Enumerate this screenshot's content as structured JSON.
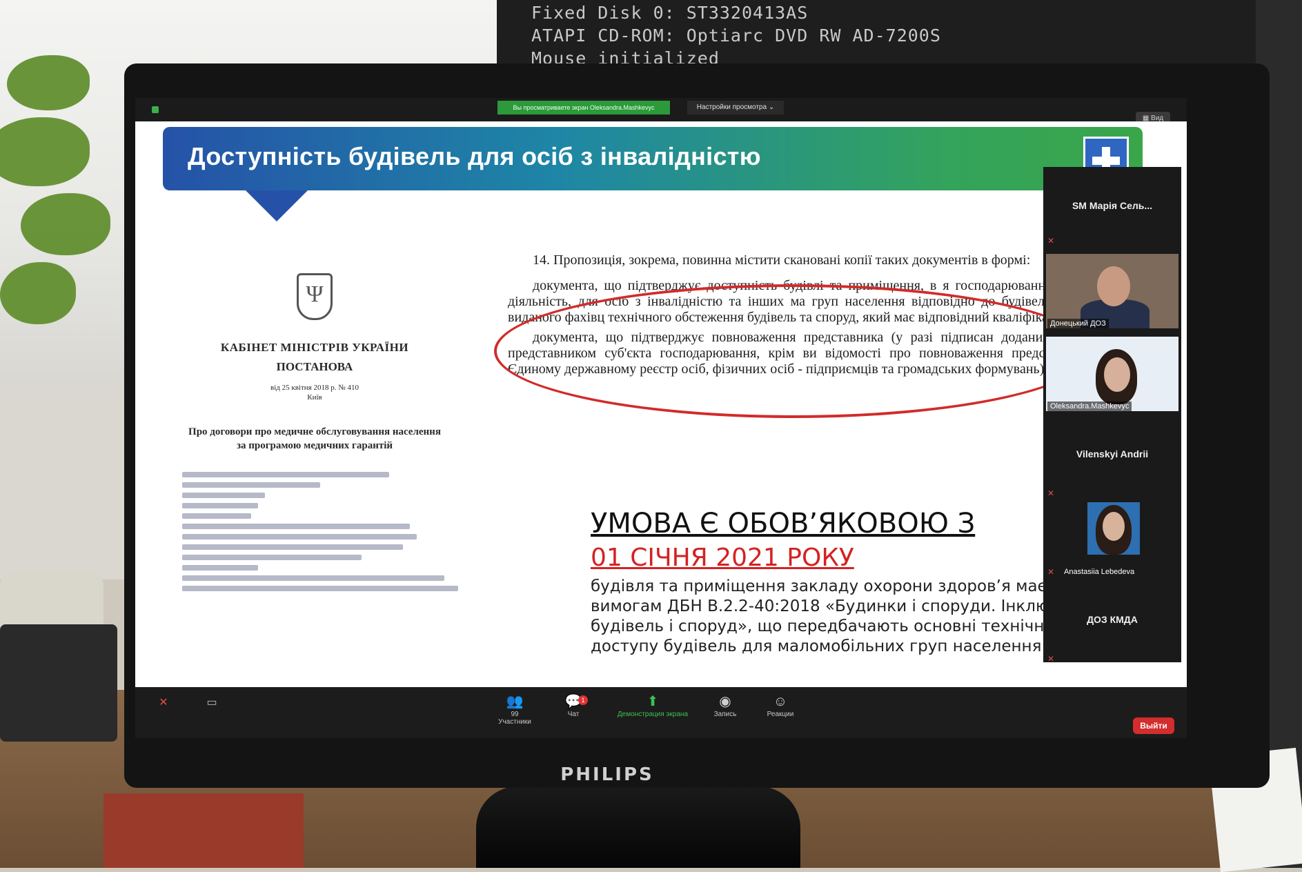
{
  "crt_lines": [
    "Fixed Disk 0: ST3320413AS",
    "ATAPI CD-ROM: Optiarc DVD RW AD-7200S",
    "Mouse initialized"
  ],
  "monitor_brand": "PHILIPS",
  "zoom": {
    "share_banner": "Вы просматриваете экран Oleksandra.Mashkevyc",
    "view_options": "Настройки просмотра ⌄",
    "view_button": "▦ Вид"
  },
  "slide": {
    "title": "Доступність будівель для осіб з інвалідністю",
    "decree": {
      "trident": "Ψ",
      "org": "КАБІНЕТ МІНІСТРІВ УКРАЇНИ",
      "kind": "ПОСТАНОВА",
      "date": "від 25 квітня 2018 р. № 410",
      "city": "Київ",
      "subject": "Про договори про медичне обслуговування населення за програмою медичних гарантій"
    },
    "paragraphs": [
      "14. Пропозиція, зокрема, повинна містити скановані копії таких документів в формі:",
      "документа, що підтверджує доступність будівлі та приміщення, в я господарювання провадитиме свою діяльність, для осіб з інвалідністю та інших ма груп населення відповідно до будівельних норм і правил, виданого фахівц технічного обстеження будівель та споруд, який має відповідний кваліфікаційний с",
      "документа, що підтверджує повноваження представника (у разі підписан доданих до неї документів представником суб'єкта господарювання, крім ви відомості про повноваження представника містяться в Єдиному державному реєстр осіб, фізичних осіб - підприємців та громадських формувань)."
    ],
    "condition_line1": "УМОВА Є ОБОВ’ЯКОВОЮ З",
    "condition_line2": "01 СІЧНЯ 2021 РОКУ",
    "condition_text": "будівля та приміщення закладу охорони здоров’я має в вимогам ДБН В.2.2-40:2018 «Будинки і споруди. Інклюз будівель і споруд», що передбачають основні технічні в доступу будівель для маломобільних груп населення"
  },
  "participants": [
    {
      "name": "SM Марія Сель...",
      "video": false
    },
    {
      "name": "Донецький ДОЗ",
      "video": true
    },
    {
      "name": "Oleksandra.Mashkevyc",
      "video": true
    },
    {
      "name": "Vilenskyi Andrii",
      "video": false
    },
    {
      "name": "Anastasiia Lebedeva",
      "video": true
    },
    {
      "name": "ДОЗ КМДА",
      "video": false
    }
  ],
  "toolbar": {
    "participants_count": "99",
    "participants_label": "Участники",
    "chat_label": "Чат",
    "chat_badge": "1",
    "share_label": "Демонстрация экрана",
    "record_label": "Запись",
    "reactions_label": "Реакции",
    "leave_label": "Выйти"
  },
  "colors": {
    "accent_green": "#2c9a3a",
    "oval_red": "#d22b2b",
    "condition_red": "#d42222",
    "leave_red": "#d32d2d",
    "header_blue": "#2552a8"
  }
}
